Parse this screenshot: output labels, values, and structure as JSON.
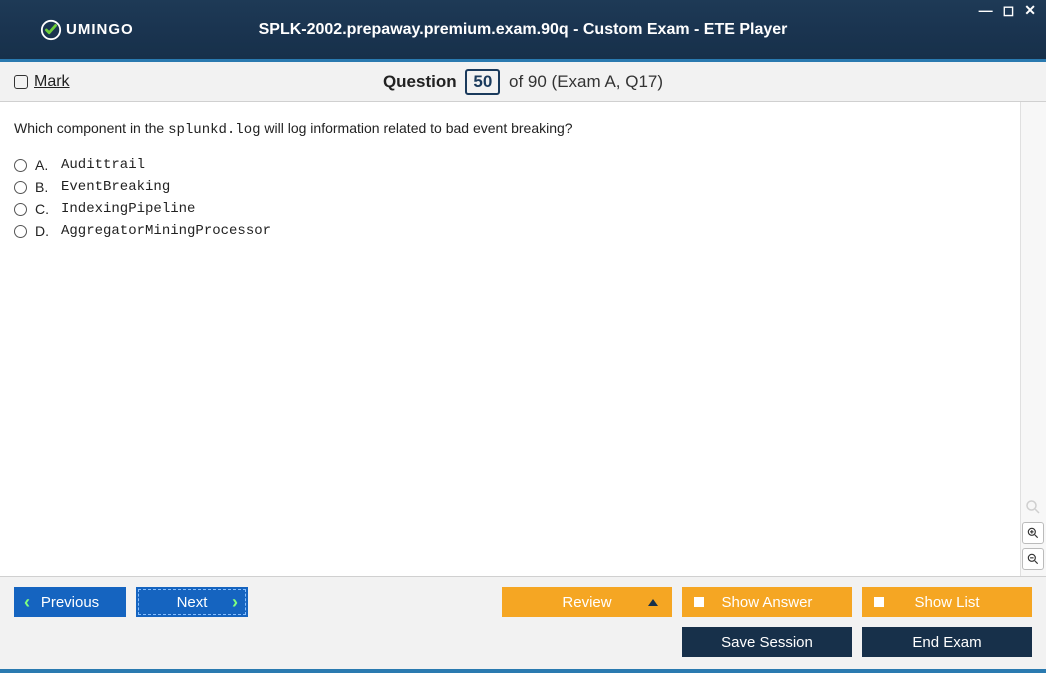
{
  "window": {
    "title": "SPLK-2002.prepaway.premium.exam.90q - Custom Exam - ETE Player",
    "logo_text": "UMINGO"
  },
  "header": {
    "mark_label": "Mark",
    "question_word": "Question",
    "current_number": "50",
    "of_text": "of 90 (Exam A, Q17)"
  },
  "question": {
    "text_before": "Which component in the ",
    "code": "splunkd.log",
    "text_after": " will log information related to bad event breaking?",
    "options": [
      {
        "letter": "A.",
        "value": "Audittrail"
      },
      {
        "letter": "B.",
        "value": "EventBreaking"
      },
      {
        "letter": "C.",
        "value": "IndexingPipeline"
      },
      {
        "letter": "D.",
        "value": "AggregatorMiningProcessor"
      }
    ]
  },
  "buttons": {
    "previous": "Previous",
    "next": "Next",
    "review": "Review",
    "show_answer": "Show Answer",
    "show_list": "Show List",
    "save_session": "Save Session",
    "end_exam": "End Exam"
  }
}
